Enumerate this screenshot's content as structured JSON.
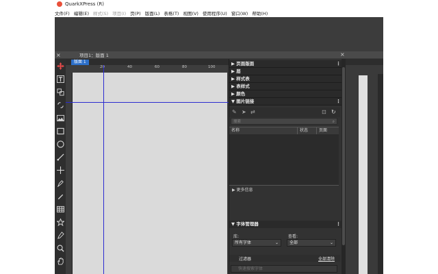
{
  "window": {
    "title": "QuarkXPress (R)"
  },
  "menu": [
    {
      "label": "文件(F)",
      "disabled": false
    },
    {
      "label": "编辑(E)",
      "disabled": false
    },
    {
      "label": "样式(S)",
      "disabled": true
    },
    {
      "label": "项目(I)",
      "disabled": true
    },
    {
      "label": "页(P)",
      "disabled": false
    },
    {
      "label": "版面(L)",
      "disabled": false
    },
    {
      "label": "表格(T)",
      "disabled": false
    },
    {
      "label": "视图(V)",
      "disabled": false
    },
    {
      "label": "使用程序(U)",
      "disabled": false
    },
    {
      "label": "窗口(W)",
      "disabled": false
    },
    {
      "label": "帮助(H)",
      "disabled": false
    }
  ],
  "document": {
    "title": "项目1：版面 1",
    "layout_tab": "版面 1",
    "close_glyph": "×"
  },
  "ruler": {
    "marks": [
      "20",
      "40",
      "60",
      "80",
      "100"
    ]
  },
  "panels": {
    "collapsed": [
      {
        "label": "▶ 页面版面"
      },
      {
        "label": "▶ 层"
      },
      {
        "label": "▶ 样式表"
      },
      {
        "label": "▶ 表样式"
      },
      {
        "label": "▶ 颜色"
      }
    ],
    "image_links": {
      "title": "▼ 图片链接",
      "search_placeholder": "搜索",
      "columns": [
        "名称",
        "状态",
        "页面"
      ]
    },
    "more_info": "▶ 更多信息",
    "font_manager": {
      "title": "▼ 字体管理器",
      "library_label": "库:",
      "library_value": "所有字体",
      "view_label": "查看:",
      "view_value": "全部",
      "filter_label": "过滤器",
      "clear_all": "全部清除",
      "search_placeholder": "快速搜索字体"
    },
    "menu_glyph": "⋮"
  },
  "colors": {
    "accent": "#2c6fc9",
    "guide": "#2a2ad0",
    "logo": "#e9503a"
  }
}
